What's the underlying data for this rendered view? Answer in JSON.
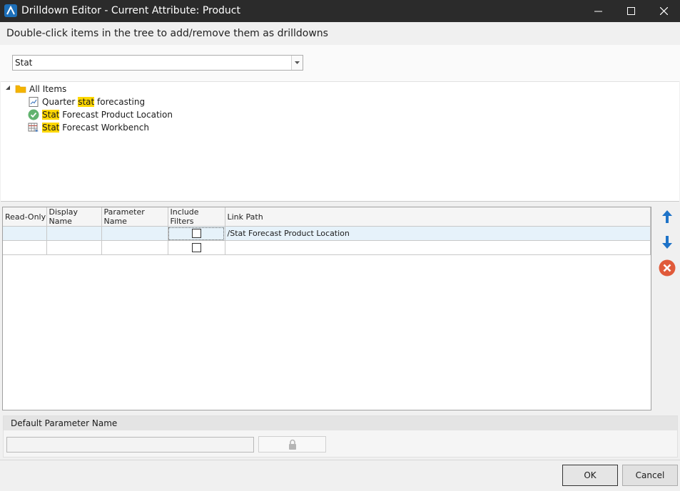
{
  "window": {
    "title": "Drilldown Editor - Current Attribute: Product",
    "controls": {
      "minimize": "minimize-icon",
      "maximize": "maximize-icon",
      "close": "close-icon"
    }
  },
  "instruction": "Double-click items in the tree to add/remove them as drilldowns",
  "filter": {
    "value": "Stat"
  },
  "tree": {
    "root": {
      "label": "All Items",
      "icon": "folder-icon"
    },
    "items": [
      {
        "pre": "Quarter ",
        "hl": "stat",
        "post": " forecasting",
        "icon": "chart-icon"
      },
      {
        "pre": "",
        "hl": "Stat",
        "post": " Forecast Product Location",
        "icon": "check-circle-icon"
      },
      {
        "pre": "",
        "hl": "Stat",
        "post": " Forecast Workbench",
        "icon": "workbench-icon"
      }
    ]
  },
  "grid": {
    "columns": [
      "Read-Only",
      "Display Name",
      "Parameter Name",
      "Include Filters",
      "Link Path"
    ],
    "rows": [
      {
        "read_only": "",
        "display_name": "",
        "parameter_name": "",
        "include_filters": false,
        "link_path": "/Stat Forecast Product Location"
      },
      {
        "read_only": "",
        "display_name": "",
        "parameter_name": "",
        "include_filters": false,
        "link_path": ""
      }
    ]
  },
  "side_actions": [
    "move-up-icon",
    "move-down-icon",
    "remove-icon"
  ],
  "default_parameter": {
    "label": "Default Parameter Name",
    "value": ""
  },
  "footer": {
    "ok": "OK",
    "cancel": "Cancel"
  },
  "colors": {
    "titlebar": "#2b2b2b",
    "accent": "#1d6fb8",
    "highlight": "#ffd700",
    "remove": "#e05a3a",
    "selected_row": "#e6f2fa"
  }
}
